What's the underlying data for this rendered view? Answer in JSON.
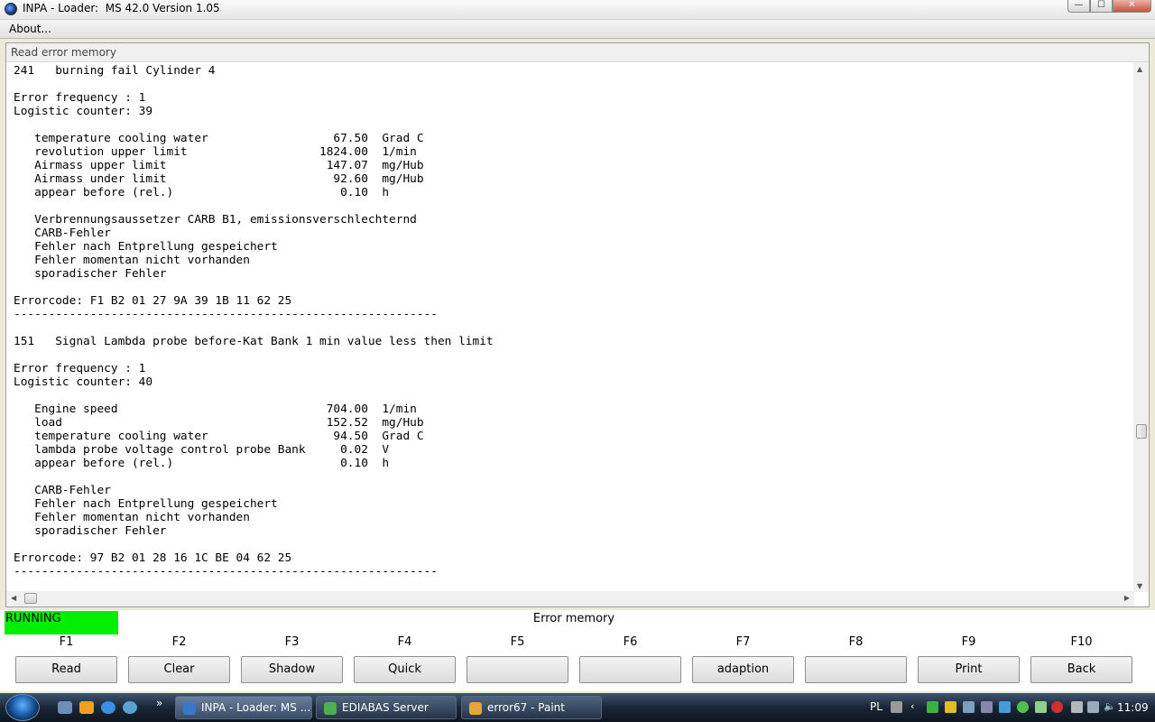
{
  "window": {
    "title": "INPA - Loader:  MS 42.0 Version 1.05",
    "controls": {
      "minimize": "—",
      "maximize": "☐",
      "close": "✕"
    }
  },
  "menu": {
    "about": "About..."
  },
  "panel": {
    "title": "Read error memory",
    "lines": [
      "241   burning fail Cylinder 4",
      "",
      "Error frequency : 1",
      "Logistic counter: 39",
      "",
      "   temperature cooling water                  67.50  Grad C",
      "   revolution upper limit                   1824.00  1/min",
      "   Airmass upper limit                       147.07  mg/Hub",
      "   Airmass under limit                        92.60  mg/Hub",
      "   appear before (rel.)                        0.10  h",
      "",
      "   Verbrennungsaussetzer CARB B1, emissionsverschlechternd",
      "   CARB-Fehler",
      "   Fehler nach Entprellung gespeichert",
      "   Fehler momentan nicht vorhanden",
      "   sporadischer Fehler",
      "",
      "Errorcode: F1 B2 01 27 9A 39 1B 11 62 25",
      "-------------------------------------------------------------",
      "",
      "151   Signal Lambda probe before-Kat Bank 1 min value less then limit",
      "",
      "Error frequency : 1",
      "Logistic counter: 40",
      "",
      "   Engine speed                              704.00  1/min",
      "   load                                      152.52  mg/Hub",
      "   temperature cooling water                  94.50  Grad C",
      "   lambda probe voltage control probe Bank     0.02  V",
      "   appear before (rel.)                        0.10  h",
      "",
      "   CARB-Fehler",
      "   Fehler nach Entprellung gespeichert",
      "   Fehler momentan nicht vorhanden",
      "   sporadischer Fehler",
      "",
      "Errorcode: 97 B2 01 28 16 1C BE 04 62 25",
      "-------------------------------------------------------------"
    ]
  },
  "status": {
    "running": "RUNNING",
    "screen_title": "Error memory"
  },
  "fkeys": [
    {
      "key": "F1",
      "label": "Read"
    },
    {
      "key": "F2",
      "label": "Clear"
    },
    {
      "key": "F3",
      "label": "Shadow"
    },
    {
      "key": "F4",
      "label": "Quick"
    },
    {
      "key": "F5",
      "label": ""
    },
    {
      "key": "F6",
      "label": ""
    },
    {
      "key": "F7",
      "label": "adaption"
    },
    {
      "key": "F8",
      "label": ""
    },
    {
      "key": "F9",
      "label": "Print"
    },
    {
      "key": "F10",
      "label": "Back"
    }
  ],
  "taskbar": {
    "tasks": [
      {
        "label": "INPA - Loader:  MS ...",
        "active": true,
        "color": "#3a78c8"
      },
      {
        "label": "EDIABAS Server",
        "active": false,
        "color": "#4caf50"
      },
      {
        "label": "error67 - Paint",
        "active": false,
        "color": "#e8a33a"
      }
    ],
    "lang": "PL",
    "clock": "11:09"
  },
  "colors": {
    "running_bg": "#00ee00",
    "taskbar": "#1a2636"
  }
}
